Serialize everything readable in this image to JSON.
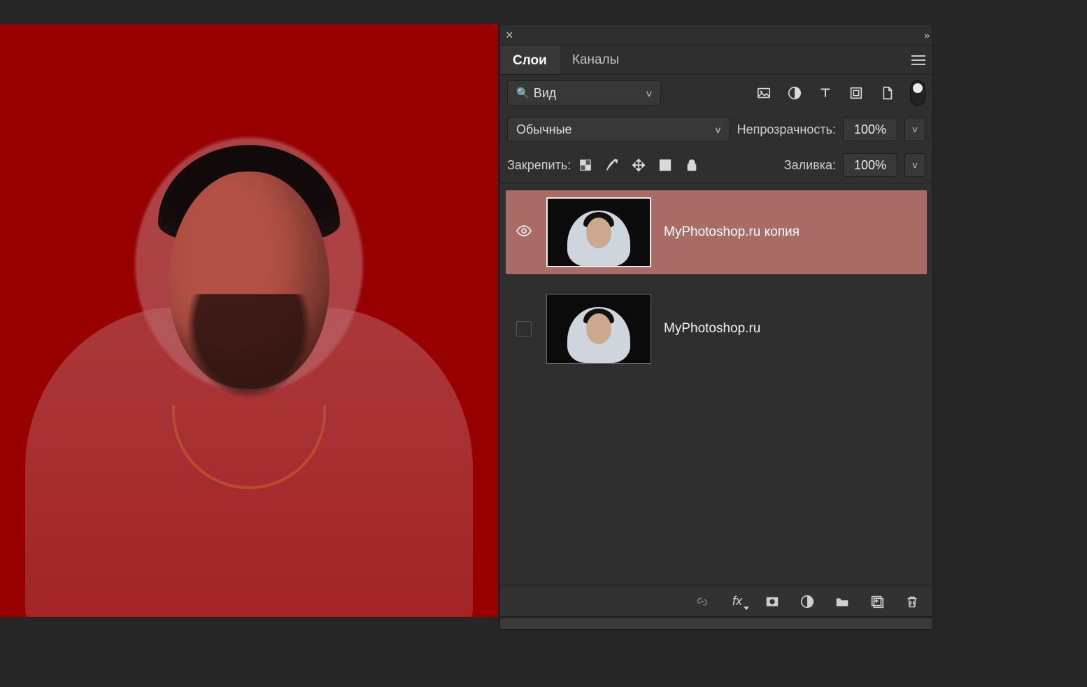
{
  "panel": {
    "tabs": {
      "layers": "Слои",
      "channels": "Каналы"
    },
    "search": {
      "label": "Вид"
    },
    "blend": {
      "mode": "Обычные",
      "opacity_label": "Непрозрачность:",
      "opacity_value": "100%"
    },
    "lock": {
      "label": "Закрепить:"
    },
    "fill": {
      "label": "Заливка:",
      "value": "100%"
    },
    "layers": [
      {
        "name": "MyPhotoshop.ru копия",
        "visible": true,
        "selected": true,
        "smart": true
      },
      {
        "name": "MyPhotoshop.ru",
        "visible": false,
        "selected": false,
        "smart": false
      }
    ],
    "footer_fx": "fx"
  }
}
